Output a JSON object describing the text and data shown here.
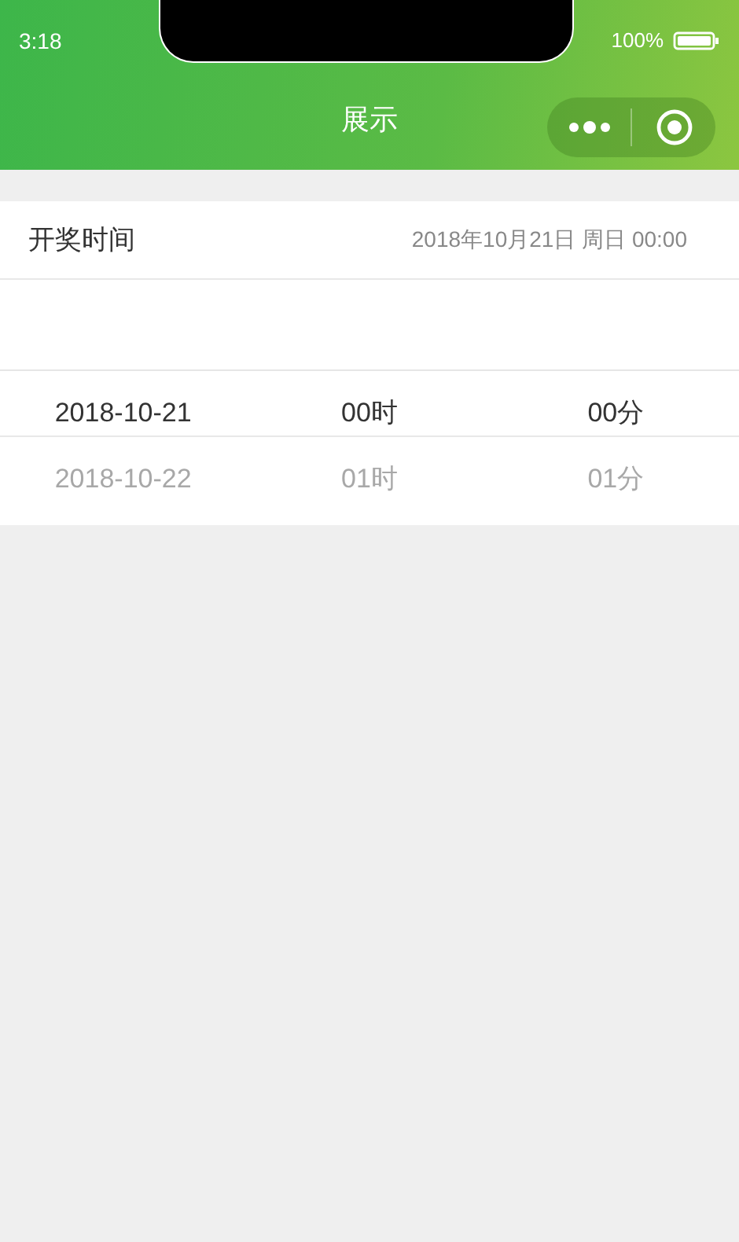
{
  "status_bar": {
    "time": "3:18",
    "battery": "100%"
  },
  "nav_bar": {
    "title": "展示"
  },
  "field": {
    "label": "开奖时间",
    "value": "2018年10月21日 周日 00:00"
  },
  "picker": {
    "columns": [
      {
        "items": [
          {
            "label": "2018-10-21",
            "selected": true
          },
          {
            "label": "2018-10-22",
            "selected": false
          }
        ]
      },
      {
        "items": [
          {
            "label": "00时",
            "selected": true
          },
          {
            "label": "01时",
            "selected": false
          }
        ]
      },
      {
        "items": [
          {
            "label": "00分",
            "selected": true
          },
          {
            "label": "01分",
            "selected": false
          }
        ]
      }
    ]
  }
}
